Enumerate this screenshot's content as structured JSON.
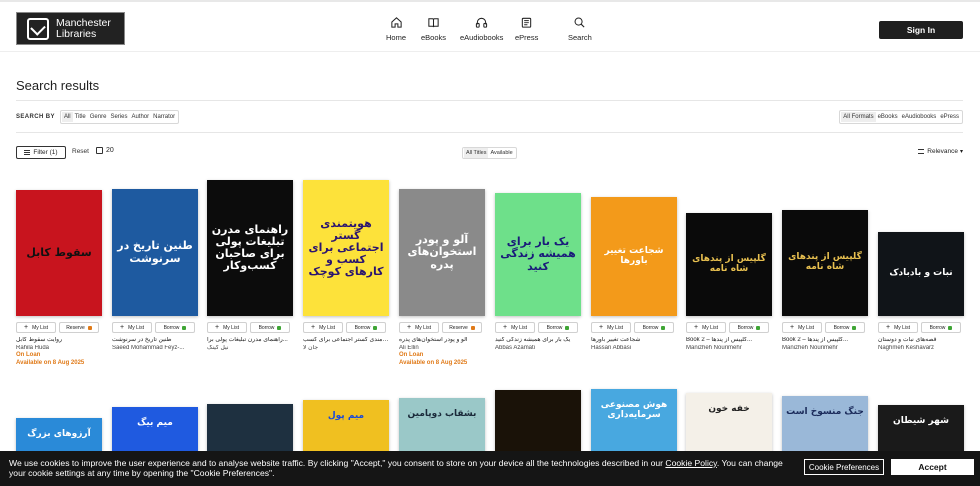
{
  "header": {
    "logo_line1": "Manchester",
    "logo_line2": "Libraries",
    "nav": [
      {
        "label": "Home",
        "icon": "home-icon"
      },
      {
        "label": "eBooks",
        "icon": "book-icon"
      },
      {
        "label": "eAudiobooks",
        "icon": "headphones-icon"
      },
      {
        "label": "ePress",
        "icon": "press-icon"
      },
      {
        "label": "Search",
        "icon": "search-icon"
      }
    ],
    "signin_label": "Sign In"
  },
  "page_title": "Search results",
  "search_by": {
    "label": "SEARCH BY",
    "options": [
      "All",
      "Title",
      "Genre",
      "Series",
      "Author",
      "Narrator"
    ],
    "selected": "All"
  },
  "formats": {
    "options": [
      "All Formats",
      "eBooks",
      "eAudiobooks",
      "ePress"
    ],
    "selected": "All Formats"
  },
  "toolbar": {
    "filter_label": "Filter (1)",
    "reset_label": "Reset",
    "count": "20",
    "titles_options": [
      "All Titles",
      "Available"
    ],
    "titles_selected": "All Titles",
    "sort_label": "Relevance"
  },
  "books": [
    {
      "cover_text": "سقوط کابل",
      "title": "روایت سقوط کابل",
      "author": "Rahila Huda",
      "action": "Reserve",
      "on_loan": "On Loan",
      "available": "Available on 8 Aug 2025",
      "colors": {
        "bg": "#c8141e",
        "fg": "#111111",
        "badge": "#e07a18"
      }
    },
    {
      "cover_text": "طنین تاریخ در سرنوشت",
      "title": "طنین تاریخ در سرنوشت",
      "author": "Saeed Mohammad Feyz-...",
      "action": "Borrow",
      "on_loan": "",
      "available": "",
      "colors": {
        "bg": "#1e5aa0",
        "fg": "#ffffff",
        "badge": "#3fa535"
      }
    },
    {
      "cover_text": "راهنمای مدرن تبلیغات پولی برای صاحبان کسب‌وکار",
      "title": "راهنمای مدرن تبلیغات پولی برا...",
      "author": "نیل کینگ",
      "action": "Borrow",
      "on_loan": "",
      "available": "",
      "colors": {
        "bg": "#0c0c0c",
        "fg": "#ffffff",
        "badge": "#3fa535"
      }
    },
    {
      "cover_text": "هویتمندی گستر اجتماعی برای کسب و کارهای کوچک",
      "title": "هویت‌مندی گستر اجتماعی برای کسب...",
      "author": "جان لا",
      "action": "Borrow",
      "on_loan": "",
      "available": "",
      "colors": {
        "bg": "#fde23a",
        "fg": "#2a1470",
        "badge": "#3fa535"
      }
    },
    {
      "cover_text": "آلو و پودر استخوان‌های پدره",
      "title": "آلو و پودر استخوان‌های پدره",
      "author": "Ali Ellin",
      "action": "Reserve",
      "on_loan": "On Loan",
      "available": "Available on 8 Aug 2025",
      "colors": {
        "bg": "#8a8a8a",
        "fg": "#ffffff",
        "badge": "#e07a18"
      }
    },
    {
      "cover_text": "یک بار برای همیشه زندگی کنید",
      "title": "یک بار برای همیشه زندگی کنید",
      "author": "Abbas Azamati",
      "action": "Borrow",
      "on_loan": "",
      "available": "",
      "colors": {
        "bg": "#6ee08a",
        "fg": "#1a1a7a",
        "badge": "#3fa535"
      }
    },
    {
      "cover_text": "شجاعت تغییر باورها",
      "title": "شجاعت تغییر باورها",
      "author": "Hassan Abbasi",
      "action": "Borrow",
      "on_loan": "",
      "available": "",
      "colors": {
        "bg": "#f39a1a",
        "fg": "#ffffff",
        "badge": "#3fa535"
      }
    },
    {
      "cover_text": "گلپیس از پندهای شاه نامه",
      "title": "Book 2 – گلپیس از پندها...",
      "author": "Manizheh Nourimehr",
      "action": "Borrow",
      "on_loan": "",
      "available": "",
      "colors": {
        "bg": "#0a0a0a",
        "fg": "#e8c050",
        "badge": "#3fa535"
      }
    },
    {
      "cover_text": "گلپیس از پندهای شاه نامه",
      "title": "Book 2 – گلپیس از پندها...",
      "author": "Manizheh Nourimehr",
      "action": "Borrow",
      "on_loan": "",
      "available": "",
      "colors": {
        "bg": "#0a0a0a",
        "fg": "#e8c050",
        "badge": "#3fa535"
      }
    },
    {
      "cover_text": "نبات و بادبادک",
      "title": "قصه‌های نبات و دوستان",
      "author": "Naghmeh Keshavarz",
      "action": "Borrow",
      "on_loan": "",
      "available": "",
      "colors": {
        "bg": "#101418",
        "fg": "#ffffff",
        "badge": "#3fa535"
      }
    }
  ],
  "books_row2": [
    {
      "cover_text": "آرزوهای بزرگ",
      "colors": {
        "bg": "#2a8ad8",
        "fg": "#ffffff"
      }
    },
    {
      "cover_text": "میم بیگ",
      "colors": {
        "bg": "#1f5ae0",
        "fg": "#ffffff"
      }
    },
    {
      "cover_text": "",
      "colors": {
        "bg": "#1e3040",
        "fg": "#ffffff"
      }
    },
    {
      "cover_text": "میم پول",
      "colors": {
        "bg": "#f0c020",
        "fg": "#1a4ad8"
      }
    },
    {
      "cover_text": "بشقاب دوپامین",
      "colors": {
        "bg": "#9ac8c8",
        "fg": "#1a2a3a"
      }
    },
    {
      "cover_text": "",
      "colors": {
        "bg": "#1a1208",
        "fg": "#e8c050"
      }
    },
    {
      "cover_text": "هوش مصنوعی سرمایه‌داری",
      "colors": {
        "bg": "#48a8e0",
        "fg": "#ffffff"
      }
    },
    {
      "cover_text": "خفه خون",
      "colors": {
        "bg": "#f4f0e8",
        "fg": "#222222"
      }
    },
    {
      "cover_text": "جنگ منسوخ است",
      "colors": {
        "bg": "#9ab8d8",
        "fg": "#1a2a5a"
      }
    },
    {
      "cover_text": "شهر شیطان",
      "colors": {
        "bg": "#1a1a1a",
        "fg": "#ffffff"
      }
    }
  ],
  "labels": {
    "my_list": "My List"
  },
  "cookie": {
    "text_before": "We use cookies to improve the user experience and to analyse website traffic. By clicking \"Accept,\" you consent to store on your device all the technologies described in our ",
    "link": "Cookie Policy",
    "text_after": ". You can change your cookie settings at any time by opening the \"Cookie Preferences\".",
    "prefs_label": "Cookie Preferences",
    "accept_label": "Accept"
  }
}
